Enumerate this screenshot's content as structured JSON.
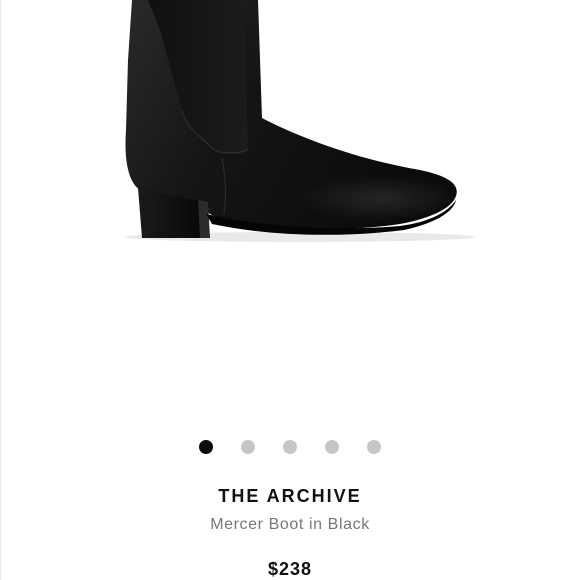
{
  "product": {
    "brand": "THE ARCHIVE",
    "name": "Mercer Boot in Black",
    "price": "$238",
    "image_icon": "black-chelsea-boot-image"
  },
  "carousel": {
    "total_slides": 5,
    "active_index": 0,
    "active_color": "#0c0c0c",
    "inactive_color": "#c6c6c6"
  }
}
